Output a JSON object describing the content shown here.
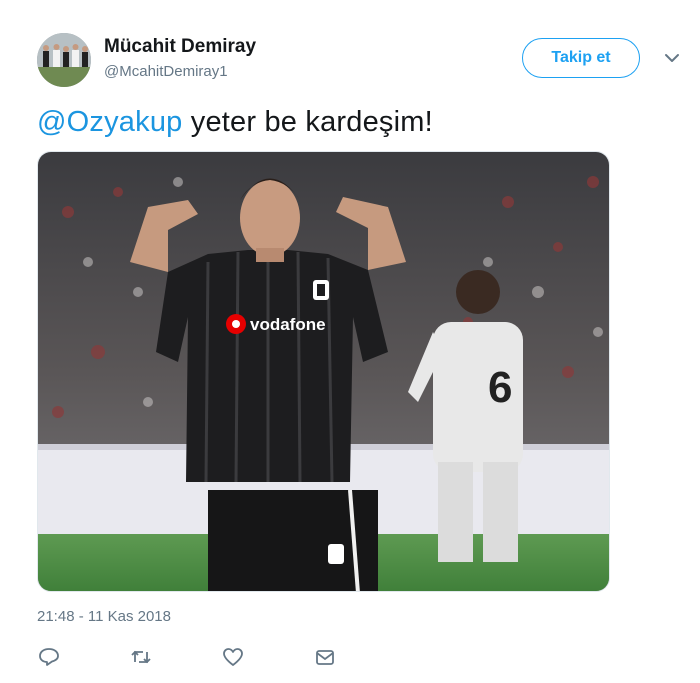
{
  "user": {
    "display_name": "Mücahit Demiray",
    "handle": "@McahitDemiray1",
    "avatar_icon": "avatar-team-photo"
  },
  "follow_button_label": "Takip et",
  "menu_icon": "chevron-down-icon",
  "tweet": {
    "mention": "@Ozyakup",
    "text": " yeter be kardeşim!"
  },
  "media": {
    "shirt_sponsor": "vodafone",
    "shirt_number": "6"
  },
  "timestamp": "21:48 - 11 Kas 2018",
  "actions": [
    "reply-icon",
    "retweet-icon",
    "like-icon",
    "message-icon"
  ],
  "colors": {
    "accent": "#1da1f2",
    "mention": "#1b95e0",
    "muted": "#657786"
  }
}
